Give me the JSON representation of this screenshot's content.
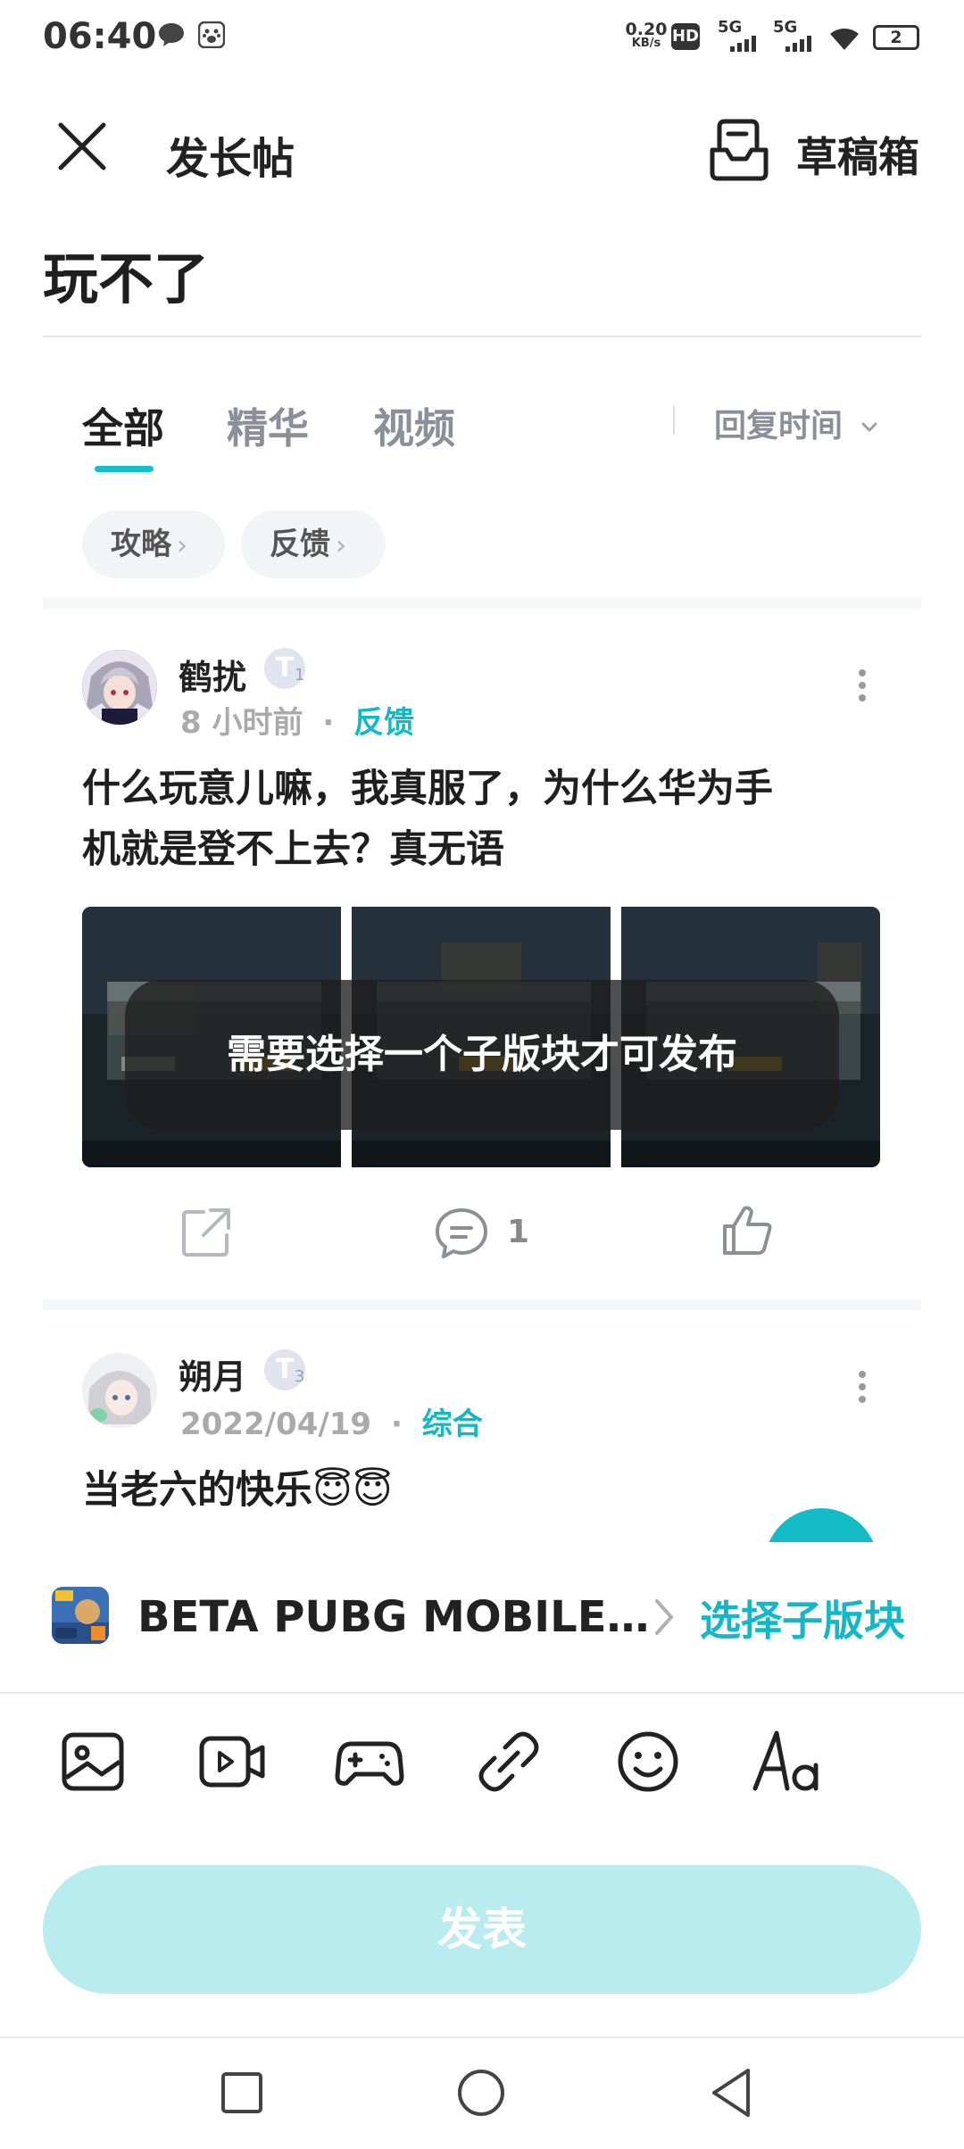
{
  "status_bar": {
    "time": "06:40",
    "net_speed_value": "0.20",
    "net_speed_unit": "KB/s",
    "hd_label": "HD",
    "signal1": "5G",
    "signal2": "5G",
    "battery": "2"
  },
  "header": {
    "title": "发长帖",
    "drafts_label": "草稿箱"
  },
  "post_title": "玩不了",
  "tabs": [
    {
      "label": "全部",
      "active": true
    },
    {
      "label": "精华",
      "active": false
    },
    {
      "label": "视频",
      "active": false
    }
  ],
  "sort": {
    "label": "回复时间"
  },
  "chips": [
    {
      "label": "攻略"
    },
    {
      "label": "反馈"
    }
  ],
  "posts": [
    {
      "author": "鹤扰",
      "badge": "T",
      "level": "1",
      "time": "8 小时前",
      "forum": "反馈",
      "body_line1": "什么玩意儿嘛，我真服了，为什么华为手",
      "body_line2": "机就是登不上去？真无语",
      "comment_count": "1"
    },
    {
      "author": "朔月",
      "badge": "T",
      "level": "3",
      "time": "2022/04/19",
      "forum": "综合",
      "body_line1": "当老六的快乐😇😇"
    }
  ],
  "toast": "需要选择一个子版块才可发布",
  "forum_bar": {
    "name": "BETA PUBG MOBILE…",
    "select_label": "选择子版块"
  },
  "toolbar": {
    "icons": [
      "image-icon",
      "video-icon",
      "gamepad-icon",
      "link-icon",
      "emoji-icon",
      "text-format-icon"
    ]
  },
  "publish_button": "发表",
  "colors": {
    "accent": "#14b7c5",
    "publish_disabled": "#b9ecef"
  }
}
